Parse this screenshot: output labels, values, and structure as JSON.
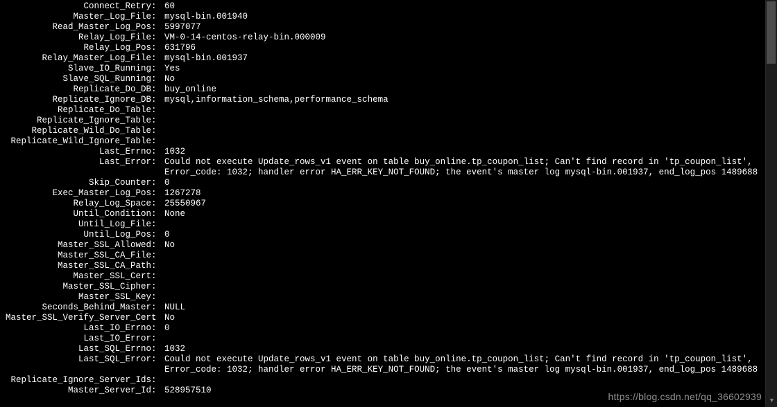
{
  "status": {
    "items": [
      {
        "label": "Connect_Retry",
        "value": "60"
      },
      {
        "label": "Master_Log_File",
        "value": "mysql-bin.001940"
      },
      {
        "label": "Read_Master_Log_Pos",
        "value": "5997077"
      },
      {
        "label": "Relay_Log_File",
        "value": "VM-0-14-centos-relay-bin.000009"
      },
      {
        "label": "Relay_Log_Pos",
        "value": "631796"
      },
      {
        "label": "Relay_Master_Log_File",
        "value": "mysql-bin.001937"
      },
      {
        "label": "Slave_IO_Running",
        "value": "Yes"
      },
      {
        "label": "Slave_SQL_Running",
        "value": "No"
      },
      {
        "label": "Replicate_Do_DB",
        "value": "buy_online"
      },
      {
        "label": "Replicate_Ignore_DB",
        "value": "mysql,information_schema,performance_schema"
      },
      {
        "label": "Replicate_Do_Table",
        "value": ""
      },
      {
        "label": "Replicate_Ignore_Table",
        "value": ""
      },
      {
        "label": "Replicate_Wild_Do_Table",
        "value": ""
      },
      {
        "label": "Replicate_Wild_Ignore_Table",
        "value": ""
      },
      {
        "label": "Last_Errno",
        "value": "1032"
      },
      {
        "label": "Last_Error",
        "value": "Could not execute Update_rows_v1 event on table buy_online.tp_coupon_list; Can't find record in 'tp_coupon_list', Error_code: 1032; handler error HA_ERR_KEY_NOT_FOUND; the event's master log mysql-bin.001937, end_log_pos 1489688",
        "wrap": true
      },
      {
        "label": "Skip_Counter",
        "value": "0"
      },
      {
        "label": "Exec_Master_Log_Pos",
        "value": "1267278"
      },
      {
        "label": "Relay_Log_Space",
        "value": "25550967"
      },
      {
        "label": "Until_Condition",
        "value": "None"
      },
      {
        "label": "Until_Log_File",
        "value": ""
      },
      {
        "label": "Until_Log_Pos",
        "value": "0"
      },
      {
        "label": "Master_SSL_Allowed",
        "value": "No"
      },
      {
        "label": "Master_SSL_CA_File",
        "value": ""
      },
      {
        "label": "Master_SSL_CA_Path",
        "value": ""
      },
      {
        "label": "Master_SSL_Cert",
        "value": ""
      },
      {
        "label": "Master_SSL_Cipher",
        "value": ""
      },
      {
        "label": "Master_SSL_Key",
        "value": ""
      },
      {
        "label": "Seconds_Behind_Master",
        "value": "NULL"
      },
      {
        "label": "Master_SSL_Verify_Server_Cert",
        "value": "No"
      },
      {
        "label": "Last_IO_Errno",
        "value": "0"
      },
      {
        "label": "Last_IO_Error",
        "value": ""
      },
      {
        "label": "Last_SQL_Errno",
        "value": "1032"
      },
      {
        "label": "Last_SQL_Error",
        "value": "Could not execute Update_rows_v1 event on table buy_online.tp_coupon_list; Can't find record in 'tp_coupon_list', Error_code: 1032; handler error HA_ERR_KEY_NOT_FOUND; the event's master log mysql-bin.001937, end_log_pos 1489688",
        "wrap": true
      },
      {
        "label": "Replicate_Ignore_Server_Ids",
        "value": ""
      },
      {
        "label": "Master_Server_Id",
        "value": "528957510"
      }
    ]
  },
  "watermark": "https://blog.csdn.net/qq_36602939"
}
